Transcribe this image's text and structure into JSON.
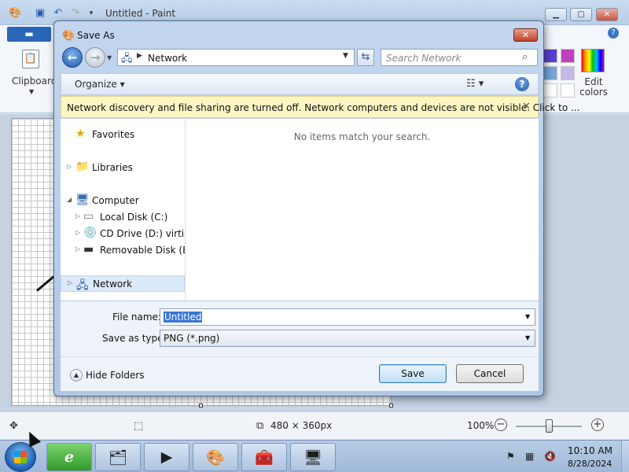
{
  "paint": {
    "title": "Untitled - Paint",
    "file_tab_label": "",
    "clipboard_label": "Clipboard",
    "edit_colors_label": "Edit colors",
    "status_dimensions": "480 × 360px",
    "zoom": "100%",
    "zoom_level_percent": 100,
    "swatch_colors": [
      "#5a3fd1",
      "#c040c0",
      "#7aa5d8",
      "#c8b8e8",
      "#ffffff",
      "#ffffff",
      "#ffffff",
      "#ffffff"
    ]
  },
  "dialog": {
    "title": "Save As",
    "address": "Network",
    "search_placeholder": "Search Network",
    "organize_label": "Organize ▾",
    "info_bar": "Network discovery and file sharing are turned off. Network computers and devices are not visible. Click to ...",
    "empty_message": "No items match your search.",
    "nav_items": [
      {
        "label": "Favorites",
        "icon": "star-icon"
      },
      {
        "label": "Libraries",
        "icon": "library-icon"
      },
      {
        "label": "Computer",
        "icon": "computer-icon"
      },
      {
        "label": "Local Disk (C:)",
        "icon": "hard-drive-icon"
      },
      {
        "label": "CD Drive (D:) virtio-w",
        "icon": "cd-drive-icon"
      },
      {
        "label": "Removable Disk (E:)",
        "icon": "removable-disk-icon"
      },
      {
        "label": "Network",
        "icon": "network-icon"
      }
    ],
    "file_name_label": "File name:",
    "file_name_value": "Untitled",
    "save_type_label": "Save as type:",
    "save_type_value": "PNG (*.png)",
    "hide_folders_label": "Hide Folders",
    "save_button": "Save",
    "cancel_button": "Cancel"
  },
  "taskbar": {
    "time": "10:10 AM",
    "date": "8/28/2024",
    "pinned": [
      "internet-explorer-icon",
      "file-explorer-icon",
      "media-player-icon",
      "paint-icon",
      "toolbox-icon",
      "control-panel-icon"
    ]
  },
  "colors": {
    "accent": "#3875d7",
    "info_bar": "#fdf6c3",
    "close_red": "#c0432b"
  }
}
